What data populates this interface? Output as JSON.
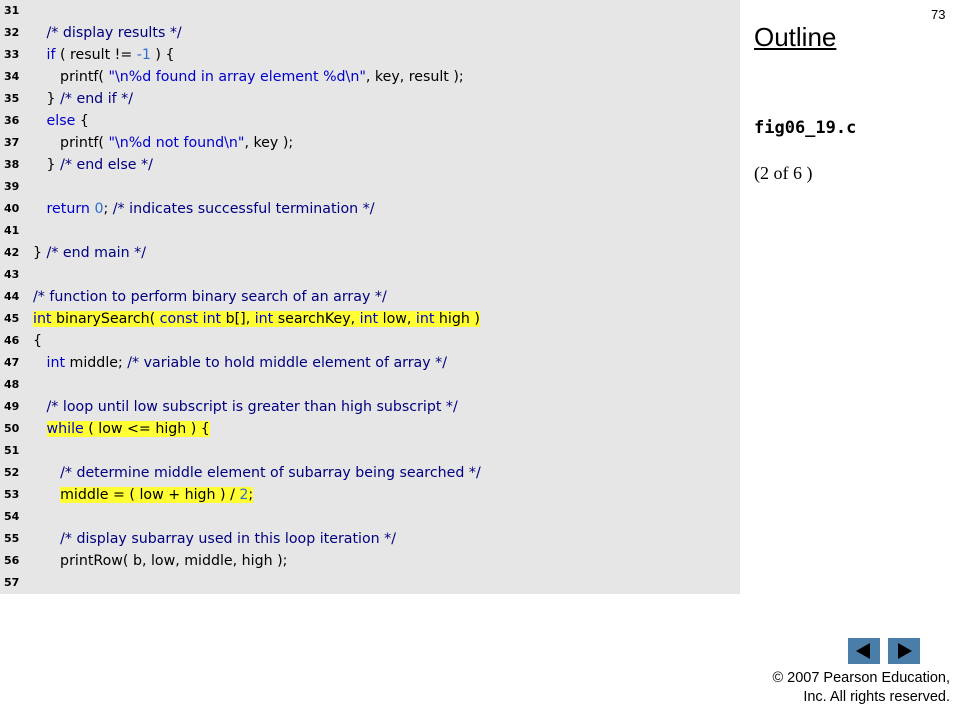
{
  "slide": {
    "page_number": "73",
    "outline_title": "Outline",
    "file_name": "fig06_19.c",
    "page_indicator": "(2 of 6 )"
  },
  "code_lines": [
    {
      "num": "31",
      "text": "",
      "highlight": false
    },
    {
      "num": "32",
      "text": "   /* display results */",
      "highlight": false
    },
    {
      "num": "33",
      "text": "   if ( result != -1 ) {",
      "highlight": false
    },
    {
      "num": "34",
      "text": "      printf( \"\\n%d found in array element %d\\n\", key, result );",
      "highlight": false
    },
    {
      "num": "35",
      "text": "   } /* end if */",
      "highlight": false
    },
    {
      "num": "36",
      "text": "   else {",
      "highlight": false
    },
    {
      "num": "37",
      "text": "      printf( \"\\n%d not found\\n\", key );",
      "highlight": false
    },
    {
      "num": "38",
      "text": "   } /* end else */",
      "highlight": false
    },
    {
      "num": "39",
      "text": "",
      "highlight": false
    },
    {
      "num": "40",
      "text": "   return 0; /* indicates successful termination */",
      "highlight": false
    },
    {
      "num": "41",
      "text": "",
      "highlight": false
    },
    {
      "num": "42",
      "text": "} /* end main */",
      "highlight": false
    },
    {
      "num": "43",
      "text": "",
      "highlight": false
    },
    {
      "num": "44",
      "text": "/* function to perform binary search of an array */",
      "highlight": false
    },
    {
      "num": "45",
      "text": "int binarySearch( const int b[], int searchKey, int low, int high )",
      "highlight": true
    },
    {
      "num": "46",
      "text": "{",
      "highlight": false
    },
    {
      "num": "47",
      "text": "   int middle; /* variable to hold middle element of array */",
      "highlight": false
    },
    {
      "num": "48",
      "text": "",
      "highlight": false
    },
    {
      "num": "49",
      "text": "   /* loop until low subscript is greater than high subscript */",
      "highlight": false
    },
    {
      "num": "50",
      "text": "   while ( low <= high ) {",
      "highlight": true
    },
    {
      "num": "51",
      "text": "",
      "highlight": false
    },
    {
      "num": "52",
      "text": "      /* determine middle element of subarray being searched */",
      "highlight": false
    },
    {
      "num": "53",
      "text": "      middle = ( low + high ) / 2;",
      "highlight": true
    },
    {
      "num": "54",
      "text": "",
      "highlight": false
    },
    {
      "num": "55",
      "text": "      /* display subarray used in this loop iteration */",
      "highlight": false
    },
    {
      "num": "56",
      "text": "      printRow( b, low, middle, high );",
      "highlight": false
    },
    {
      "num": "57",
      "text": "",
      "highlight": false
    }
  ],
  "navigation": {
    "prev_icon": "triangle-left-icon",
    "next_icon": "triangle-right-icon"
  },
  "copyright": {
    "line1": "© 2007 Pearson Education,",
    "line2": "Inc.  All rights reserved."
  },
  "colors": {
    "code_background": "#e6e6e6",
    "highlight": "#ffff33",
    "keyword": "#0000cc",
    "comment": "#000080",
    "nav_button": "#4a7da8"
  }
}
